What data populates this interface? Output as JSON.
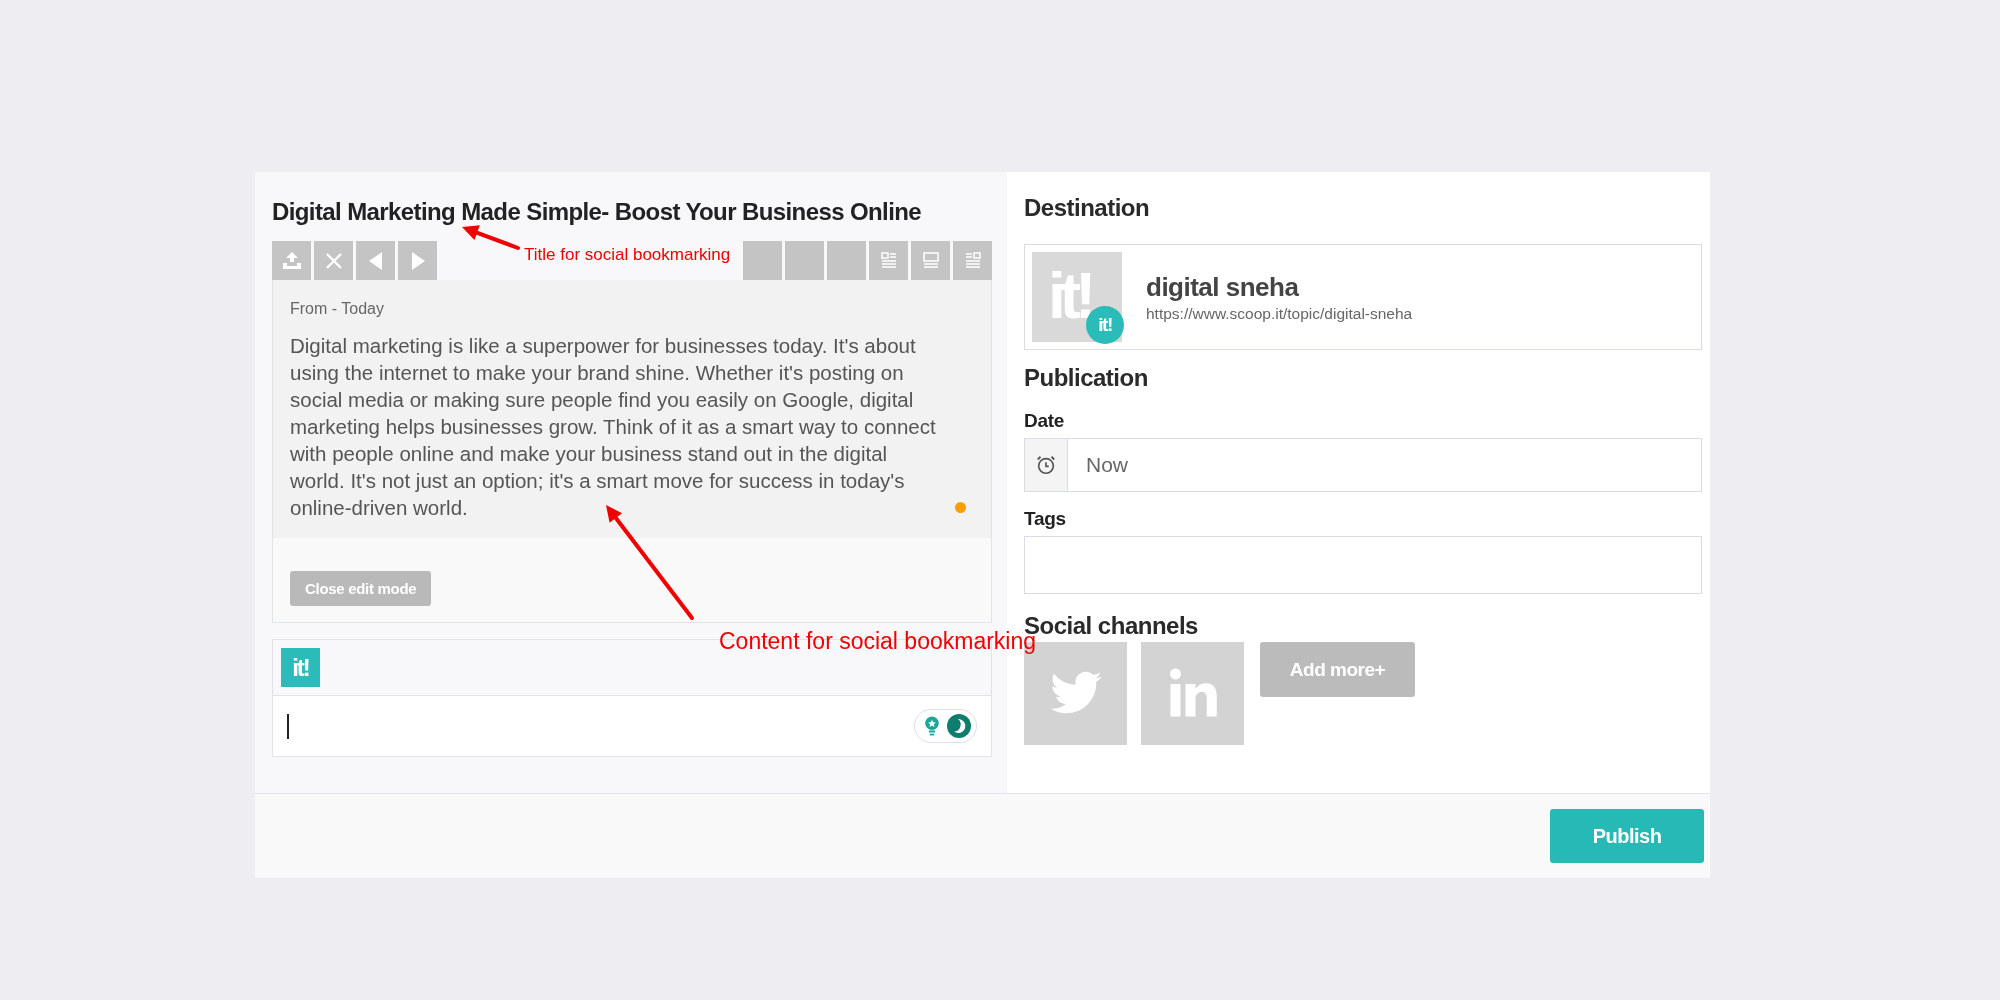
{
  "post": {
    "title": "Digital Marketing Made Simple- Boost Your Business Online",
    "source": "From - Today",
    "content": "Digital marketing is like a superpower for businesses today. It's about using the internet to make your brand shine. Whether it's posting on social media or making sure people find you easily on Google, digital marketing helps businesses grow. Think of it as a smart way to connect with people online and make your business stand out in the digital world. It's not just an option; it's a smart move for success in today's online-driven world.",
    "close_button": "Close edit mode"
  },
  "comment": {
    "logo_text": "it!"
  },
  "destination": {
    "heading": "Destination",
    "thumb_text": "it!",
    "badge_text": "it!",
    "name": "digital sneha",
    "url": "https://www.scoop.it/topic/digital-sneha"
  },
  "publication": {
    "heading": "Publication",
    "date_label": "Date",
    "date_value": "Now",
    "tags_label": "Tags"
  },
  "social": {
    "heading": "Social channels",
    "channels": [
      {
        "kind": "twitter"
      },
      {
        "kind": "linkedin"
      }
    ],
    "add_button": "Add more+"
  },
  "footer": {
    "publish_button": "Publish"
  },
  "annotations": [
    {
      "text": "Title for social bookmarking"
    },
    {
      "text": "Content for social bookmarking"
    }
  ]
}
